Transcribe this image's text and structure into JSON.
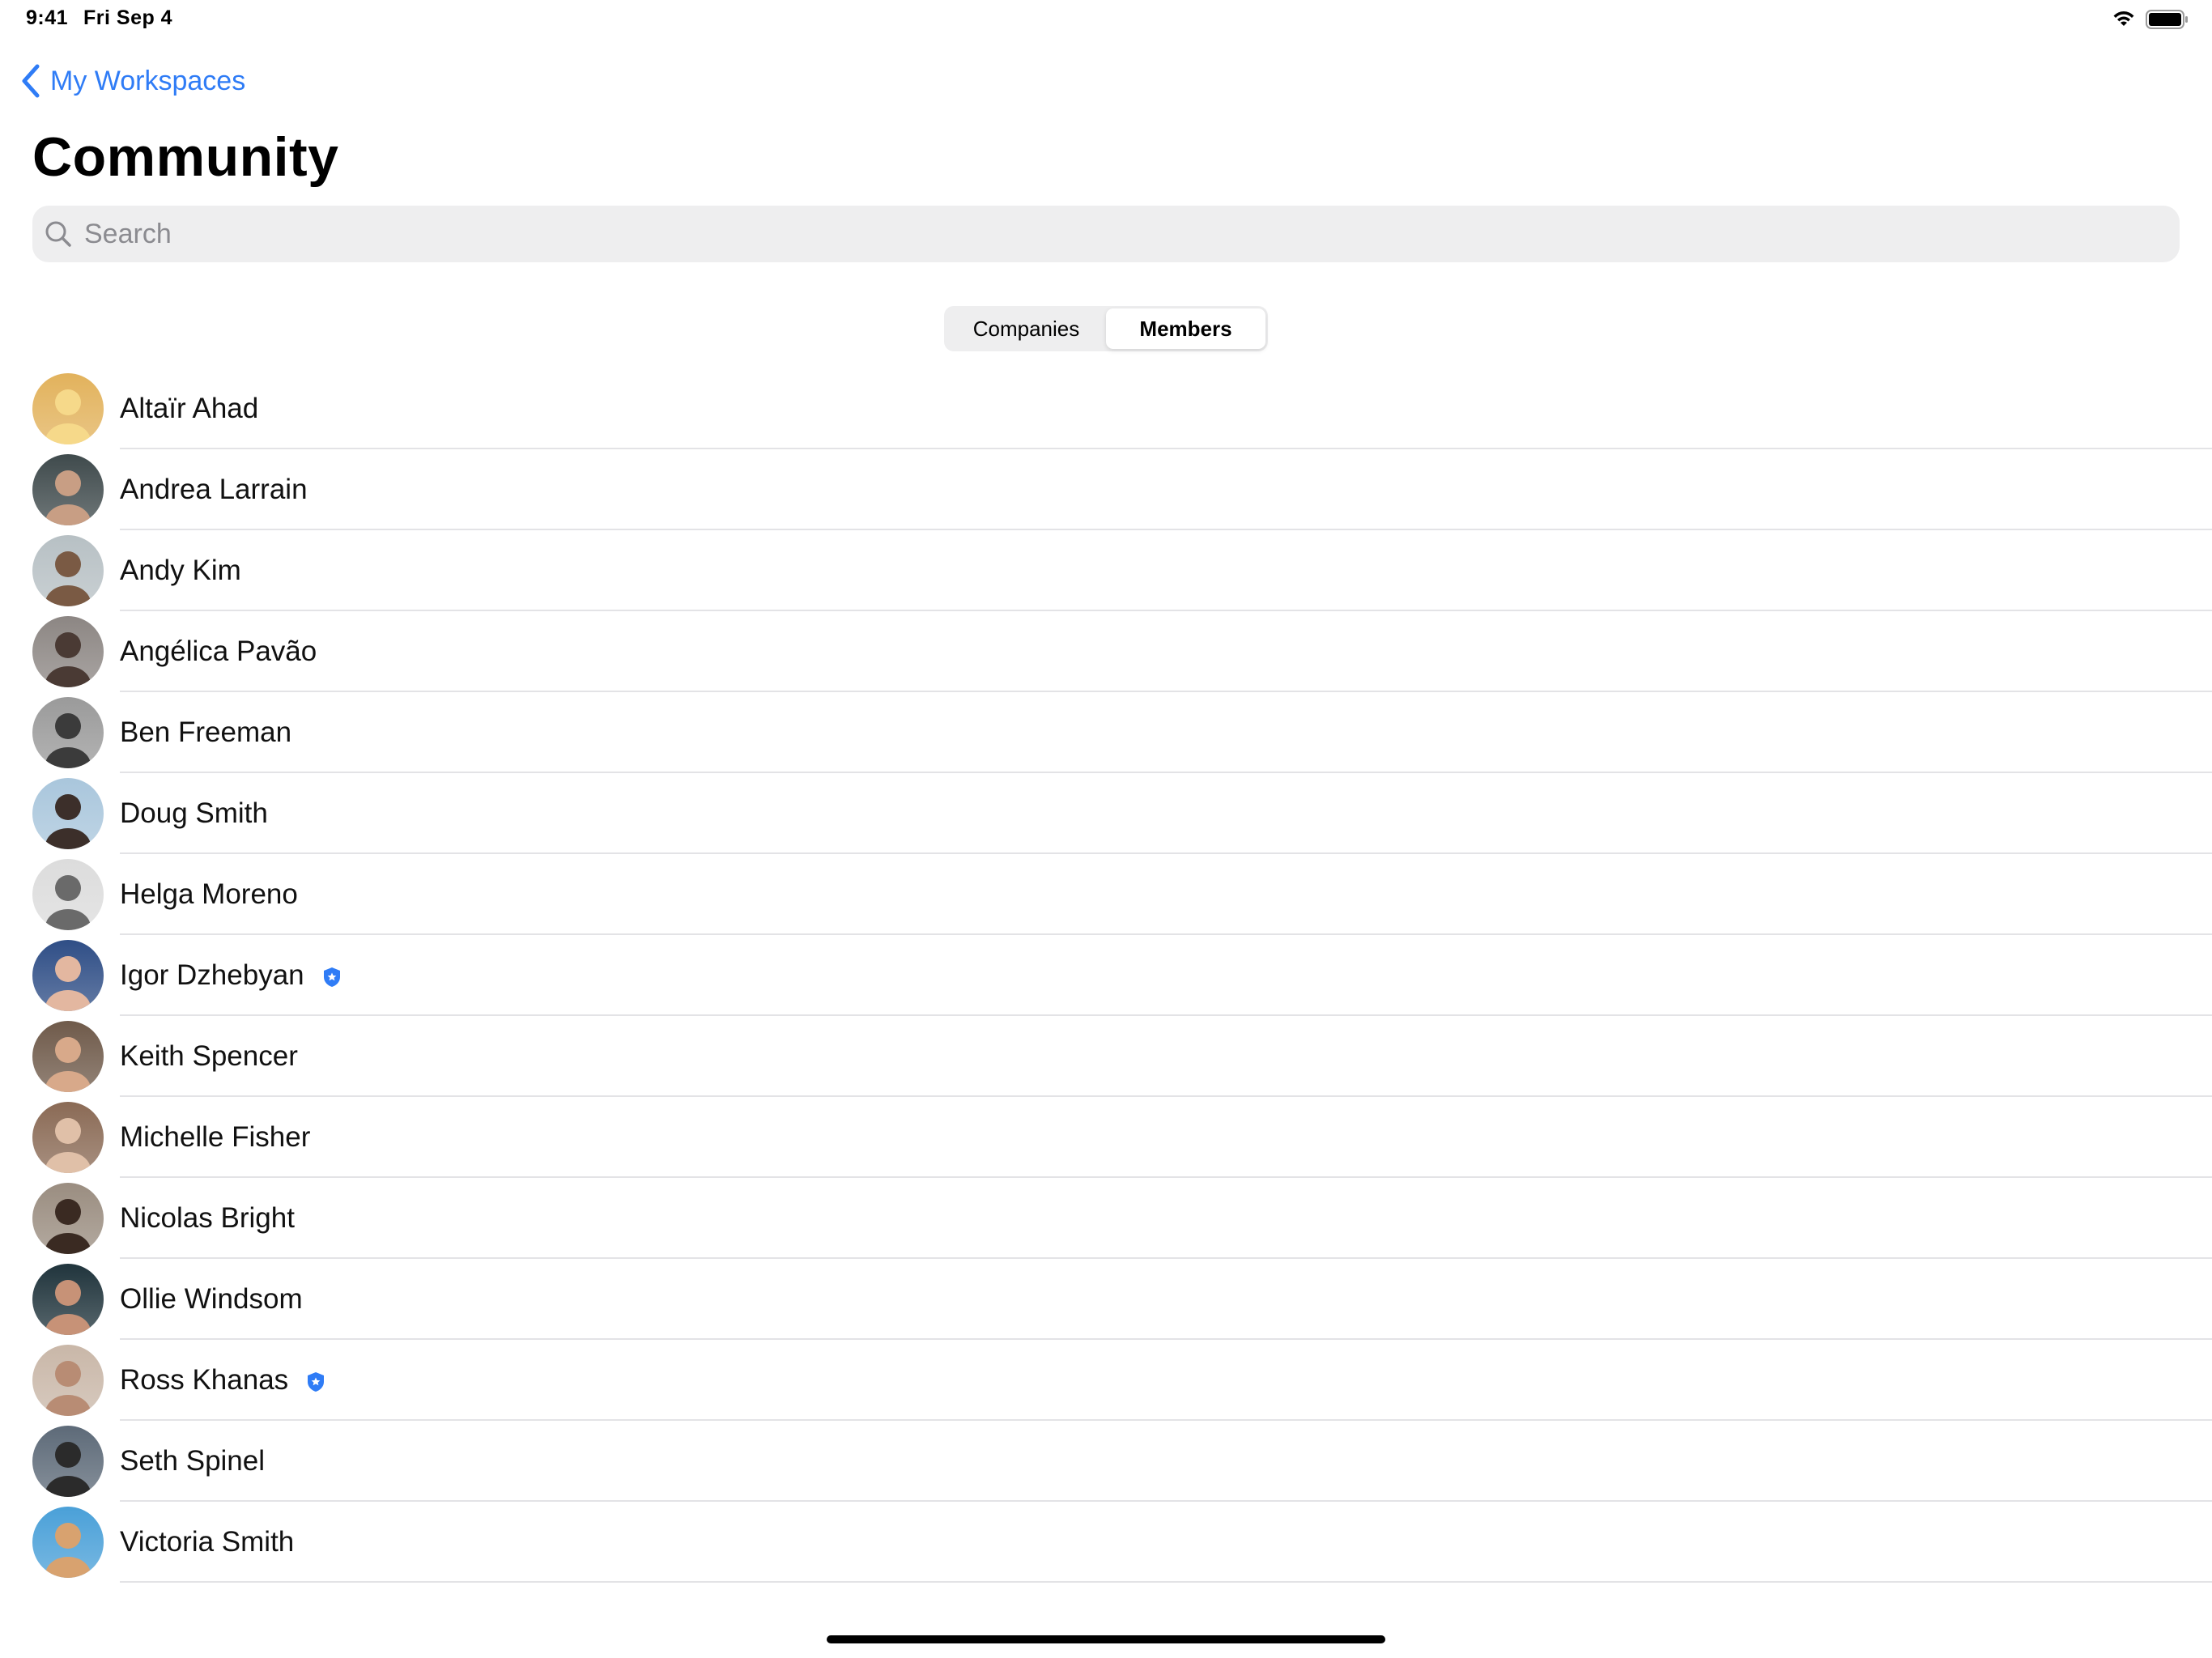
{
  "status_bar": {
    "time": "9:41",
    "date": "Fri Sep 4",
    "wifi_icon": "wifi-icon",
    "battery_icon": "battery-icon"
  },
  "nav": {
    "back_label": "My Workspaces",
    "back_icon": "chevron-left-icon",
    "accent_color": "#2f7cf6"
  },
  "page": {
    "title": "Community"
  },
  "search": {
    "placeholder": "Search",
    "value": "",
    "icon": "search-icon"
  },
  "segments": {
    "items": [
      {
        "label": "Companies",
        "selected": false
      },
      {
        "label": "Members",
        "selected": true
      }
    ]
  },
  "members": [
    {
      "name": "Altaïr Ahad",
      "verified": false,
      "avatar_colors": [
        "#e2b25c",
        "#f6d98a"
      ]
    },
    {
      "name": "Andrea Larrain",
      "verified": false,
      "avatar_colors": [
        "#3f4a4c",
        "#c89e84"
      ]
    },
    {
      "name": "Andy Kim",
      "verified": false,
      "avatar_colors": [
        "#b7c0c4",
        "#7a5a44"
      ]
    },
    {
      "name": "Angélica Pavão",
      "verified": false,
      "avatar_colors": [
        "#8c8683",
        "#4a3a34"
      ]
    },
    {
      "name": "Ben Freeman",
      "verified": false,
      "avatar_colors": [
        "#9a9a9a",
        "#3b3b3b"
      ]
    },
    {
      "name": "Doug Smith",
      "verified": false,
      "avatar_colors": [
        "#a9c6dc",
        "#3c2f2a"
      ]
    },
    {
      "name": "Helga Moreno",
      "verified": false,
      "avatar_colors": [
        "#dcdcdc",
        "#6a6a6a"
      ]
    },
    {
      "name": "Igor Dzhebyan",
      "verified": true,
      "avatar_colors": [
        "#2f4e86",
        "#e3b7a0"
      ]
    },
    {
      "name": "Keith Spencer",
      "verified": false,
      "avatar_colors": [
        "#6f5a4a",
        "#d8a98a"
      ]
    },
    {
      "name": "Michelle Fisher",
      "verified": false,
      "avatar_colors": [
        "#8a6a55",
        "#e0c0a8"
      ]
    },
    {
      "name": "Nicolas Bright",
      "verified": false,
      "avatar_colors": [
        "#9a8d80",
        "#3a2a22"
      ]
    },
    {
      "name": "Ollie Windsom",
      "verified": false,
      "avatar_colors": [
        "#20343c",
        "#c79277"
      ]
    },
    {
      "name": "Ross Khanas",
      "verified": true,
      "avatar_colors": [
        "#c9b7a8",
        "#b88c74"
      ]
    },
    {
      "name": "Seth Spinel",
      "verified": false,
      "avatar_colors": [
        "#5d6a78",
        "#2b2b2b"
      ]
    },
    {
      "name": "Victoria Smith",
      "verified": false,
      "avatar_colors": [
        "#4aa0d8",
        "#d8a26f"
      ]
    }
  ],
  "verified_icon": "verified-badge-icon",
  "home_indicator": "home-indicator"
}
